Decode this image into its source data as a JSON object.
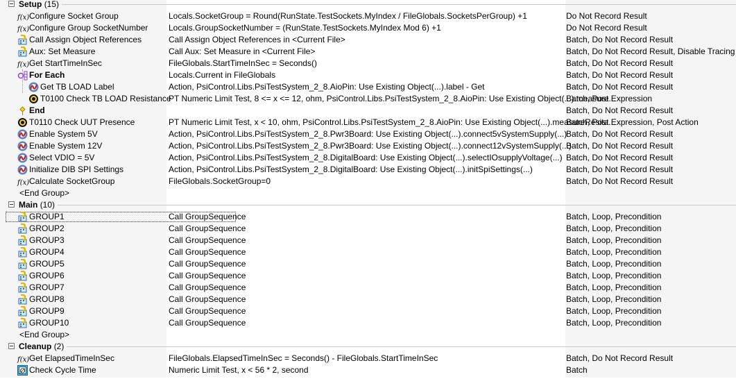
{
  "groups": [
    {
      "label": "Setup",
      "count": "(15)",
      "end_label": "<End Group>",
      "steps": [
        {
          "name": "Configure Socket Group",
          "description": "Locals.SocketGroup = Round(RunState.TestSockets.MyIndex / FileGlobals.SocketsPerGroup) +1",
          "settings": "Do Not Record Result",
          "icon": "fx-icon",
          "indent": 0
        },
        {
          "name": "Configure Group SocketNumber",
          "description": "Locals.GroupSocketNumber = (RunState.TestSockets.MyIndex Mod 6) +1",
          "settings": "Do Not Record Result",
          "icon": "fx-icon",
          "indent": 0
        },
        {
          "name": "Call Assign Object References",
          "description": "Call Assign Object References in <Current File>",
          "settings": "Batch, Do Not Record Result",
          "icon": "sequence-call-icon",
          "indent": 0
        },
        {
          "name": "Aux: Set Measure",
          "description": "Call Aux: Set Measure in <Current File>",
          "settings": "Batch, Do Not Record Result, Disable Tracing",
          "icon": "sequence-call-icon",
          "indent": 0
        },
        {
          "name": "Get StartTimeInSec",
          "description": "FileGlobals.StartTimeInSec = Seconds()",
          "settings": "Batch, Do Not Record Result",
          "icon": "fx-icon",
          "indent": 0
        },
        {
          "name": "For Each",
          "description": "Locals.Current          in FileGlobals",
          "settings": "Batch, Do Not Record Result",
          "icon": "for-each-icon",
          "indent": 0,
          "bold": true
        },
        {
          "name": "Get TB LOAD Label",
          "description": "Action,  PsiControl.Libs.PsiTestSystem_2_8.AioPin: Use Existing Object(...).label - Get",
          "settings": "Batch, Do Not Record Result",
          "icon": "action-icon",
          "indent": 1
        },
        {
          "name": "T0100 Check TB LOAD Resistance",
          "description": "PT Numeric Limit Test,  8 <= x <= 12, ohm, PsiControl.Libs.PsiTestSystem_2_8.AioPin: Use Existing Object(...).measure...",
          "settings": "Batch, Post Expression",
          "icon": "limit-test-icon",
          "indent": 1
        },
        {
          "name": "End",
          "description": "",
          "settings": "Batch, Do Not Record Result",
          "icon": "end-icon",
          "indent": 0,
          "bold": true
        },
        {
          "name": "T0110 Check UUT Presence",
          "description": "PT Numeric Limit Test,  x < 10, ohm, PsiControl.Libs.PsiTestSystem_2_8.AioPin: Use Existing Object(...).measureResita...",
          "settings": "Batch, Post Expression, Post Action",
          "icon": "limit-test-icon",
          "indent": 0
        },
        {
          "name": "Enable System 5V",
          "description": "Action,  PsiControl.Libs.PsiTestSystem_2_8.Pwr3Board: Use Existing Object(...).connect5vSystemSupply(...)",
          "settings": "Batch, Do Not Record Result",
          "icon": "action-icon",
          "indent": 0
        },
        {
          "name": "Enable System 12V",
          "description": "Action,  PsiControl.Libs.PsiTestSystem_2_8.Pwr3Board: Use Existing Object(...).connect12vSystemSupply(...)",
          "settings": "Batch, Do Not Record Result",
          "icon": "action-icon",
          "indent": 0
        },
        {
          "name": "Select VDIO = 5V",
          "description": "Action,  PsiControl.Libs.PsiTestSystem_2_8.DigitalBoard: Use Existing Object(...).selectIOsupplyVoltage(...)",
          "settings": "Batch, Do Not Record Result",
          "icon": "action-icon",
          "indent": 0
        },
        {
          "name": "Initialize DIB SPI Settings",
          "description": "Action,  PsiControl.Libs.PsiTestSystem_2_8.DigitalBoard: Use Existing Object(...).initSpiSettings(...)",
          "settings": "Batch, Do Not Record Result",
          "icon": "action-icon",
          "indent": 0
        },
        {
          "name": "Calculate SocketGroup",
          "description": "FileGlobals.SocketGroup=0",
          "settings": "Batch, Do Not Record Result",
          "icon": "fx-icon",
          "indent": 0
        }
      ]
    },
    {
      "label": "Main",
      "count": "(10)",
      "end_label": "<End Group>",
      "steps": [
        {
          "name": "GROUP1",
          "description": "Call GroupSequence",
          "settings": "Batch, Loop, Precondition",
          "icon": "sequence-call-icon",
          "indent": 0,
          "focused": true
        },
        {
          "name": "GROUP2",
          "description": "Call GroupSequence",
          "settings": "Batch, Loop, Precondition",
          "icon": "sequence-call-icon",
          "indent": 0
        },
        {
          "name": "GROUP3",
          "description": "Call GroupSequence",
          "settings": "Batch, Loop, Precondition",
          "icon": "sequence-call-icon",
          "indent": 0
        },
        {
          "name": "GROUP4",
          "description": "Call GroupSequence",
          "settings": "Batch, Loop, Precondition",
          "icon": "sequence-call-icon",
          "indent": 0
        },
        {
          "name": "GROUP5",
          "description": "Call GroupSequence",
          "settings": "Batch, Loop, Precondition",
          "icon": "sequence-call-icon",
          "indent": 0
        },
        {
          "name": "GROUP6",
          "description": "Call GroupSequence",
          "settings": "Batch, Loop, Precondition",
          "icon": "sequence-call-icon",
          "indent": 0
        },
        {
          "name": "GROUP7",
          "description": "Call GroupSequence",
          "settings": "Batch, Loop, Precondition",
          "icon": "sequence-call-icon",
          "indent": 0
        },
        {
          "name": "GROUP8",
          "description": "Call GroupSequence",
          "settings": "Batch, Loop, Precondition",
          "icon": "sequence-call-icon",
          "indent": 0
        },
        {
          "name": "GROUP9",
          "description": "Call GroupSequence",
          "settings": "Batch, Loop, Precondition",
          "icon": "sequence-call-icon",
          "indent": 0
        },
        {
          "name": "GROUP10",
          "description": "Call GroupSequence",
          "settings": "Batch, Loop, Precondition",
          "icon": "sequence-call-icon",
          "indent": 0
        }
      ]
    },
    {
      "label": "Cleanup",
      "count": "(2)",
      "steps": [
        {
          "name": "Get ElapsedTimeInSec",
          "description": "FileGlobals.ElapsedTimeInSec = Seconds() - FileGlobals.StartTimeInSec",
          "settings": "Batch, Do Not Record Result",
          "icon": "fx-icon",
          "indent": 0
        },
        {
          "name": "Check Cycle Time",
          "description": "Numeric Limit Test,  x < 56 * 2, second",
          "settings": "Batch",
          "icon": "numeric-test-icon",
          "indent": 0
        }
      ]
    }
  ],
  "colors": {
    "column_bg": "#f5f5f5",
    "group_line": "#c8c8c8"
  }
}
